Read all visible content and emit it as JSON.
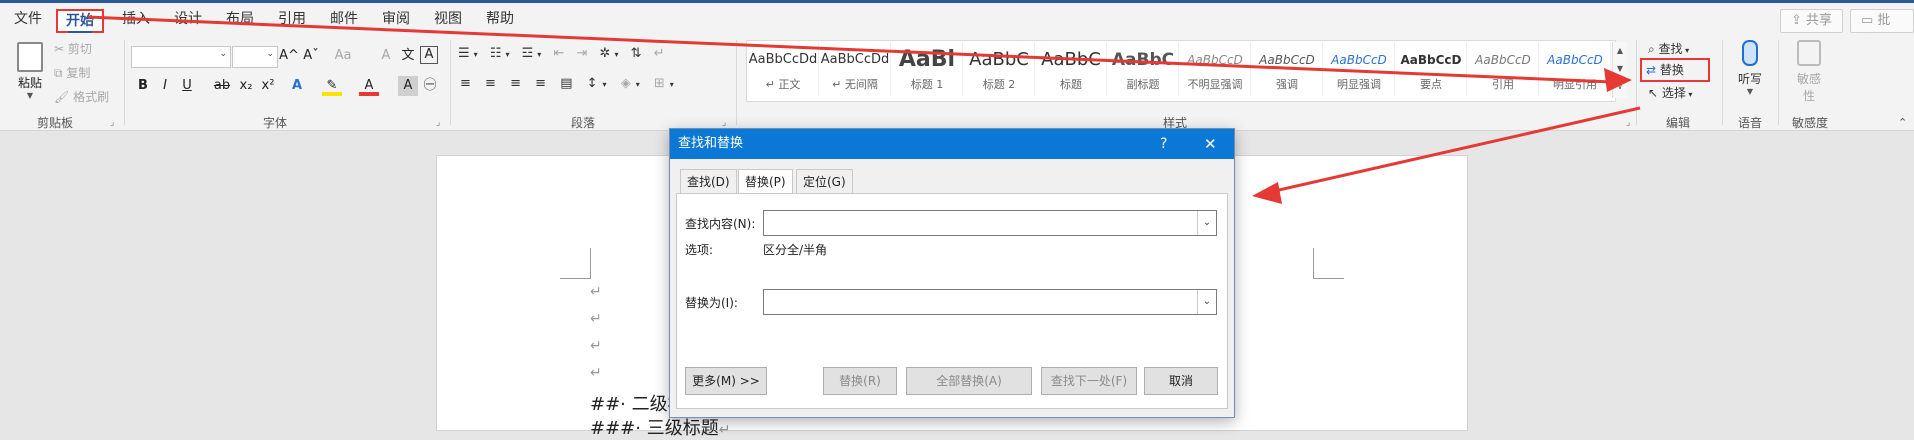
{
  "menubar": {
    "items": [
      "文件",
      "开始",
      "插入",
      "设计",
      "布局",
      "引用",
      "邮件",
      "审阅",
      "视图",
      "帮助"
    ],
    "share": "共享",
    "comments": "批注"
  },
  "clipboard": {
    "paste": "粘贴",
    "cut": "剪切",
    "copy": "复制",
    "format_painter": "格式刷",
    "label": "剪贴板"
  },
  "font": {
    "label": "字体",
    "glyphs": {
      "bold": "B",
      "italic": "I",
      "underline": "U",
      "strike": "ab",
      "subscript": "x₂",
      "superscript": "x²",
      "grow": "A^",
      "shrink": "Aˇ",
      "change_case": "Aa",
      "clear_format": "A",
      "char_border": "A",
      "text_effects": "A",
      "font_color": "A",
      "char_shading": "A"
    }
  },
  "paragraph": {
    "label": "段落"
  },
  "styles": {
    "label": "样式",
    "tiles": [
      {
        "sample": "AaBbCcDd",
        "name": "↵ 正文"
      },
      {
        "sample": "AaBbCcDd",
        "name": "↵ 无间隔"
      },
      {
        "sample": "AaBl",
        "name": "标题 1"
      },
      {
        "sample": "AaBbC",
        "name": "标题 2"
      },
      {
        "sample": "AaBbC",
        "name": "标题"
      },
      {
        "sample": "AaBbC",
        "name": "副标题"
      },
      {
        "sample": "AaBbCcD",
        "name": "不明显强调"
      },
      {
        "sample": "AaBbCcD",
        "name": "强调"
      },
      {
        "sample": "AaBbCcD",
        "name": "明显强调"
      },
      {
        "sample": "AaBbCcD",
        "name": "要点"
      },
      {
        "sample": "AaBbCcD",
        "name": "引用"
      },
      {
        "sample": "AaBbCcD",
        "name": "明显引用"
      }
    ]
  },
  "editing": {
    "find": "查找",
    "replace": "替换",
    "select": "选择",
    "label": "编辑"
  },
  "voice": {
    "dictate": "听写",
    "label": "语音"
  },
  "sensitivity": {
    "line1": "敏感",
    "line2": "性",
    "label": "敏感度"
  },
  "document": {
    "line1": "##· 二级标",
    "line2": "###· 三级标题"
  },
  "dialog": {
    "title": "查找和替换",
    "help": "?",
    "close": "✕",
    "tabs": [
      "查找(D)",
      "替换(P)",
      "定位(G)"
    ],
    "find_label": "查找内容(N):",
    "find_value": "",
    "options_label": "选项:",
    "options_value": "区分全/半角",
    "replace_label": "替换为(I):",
    "replace_value": "",
    "buttons": {
      "more": "更多(M) >>",
      "replace": "替换(R)",
      "replace_all": "全部替换(A)",
      "find_next": "查找下一处(F)",
      "cancel": "取消"
    }
  },
  "colors": {
    "accent": "#2b579a",
    "dialog_title": "#0a78d4",
    "annotation": "#e53935"
  }
}
